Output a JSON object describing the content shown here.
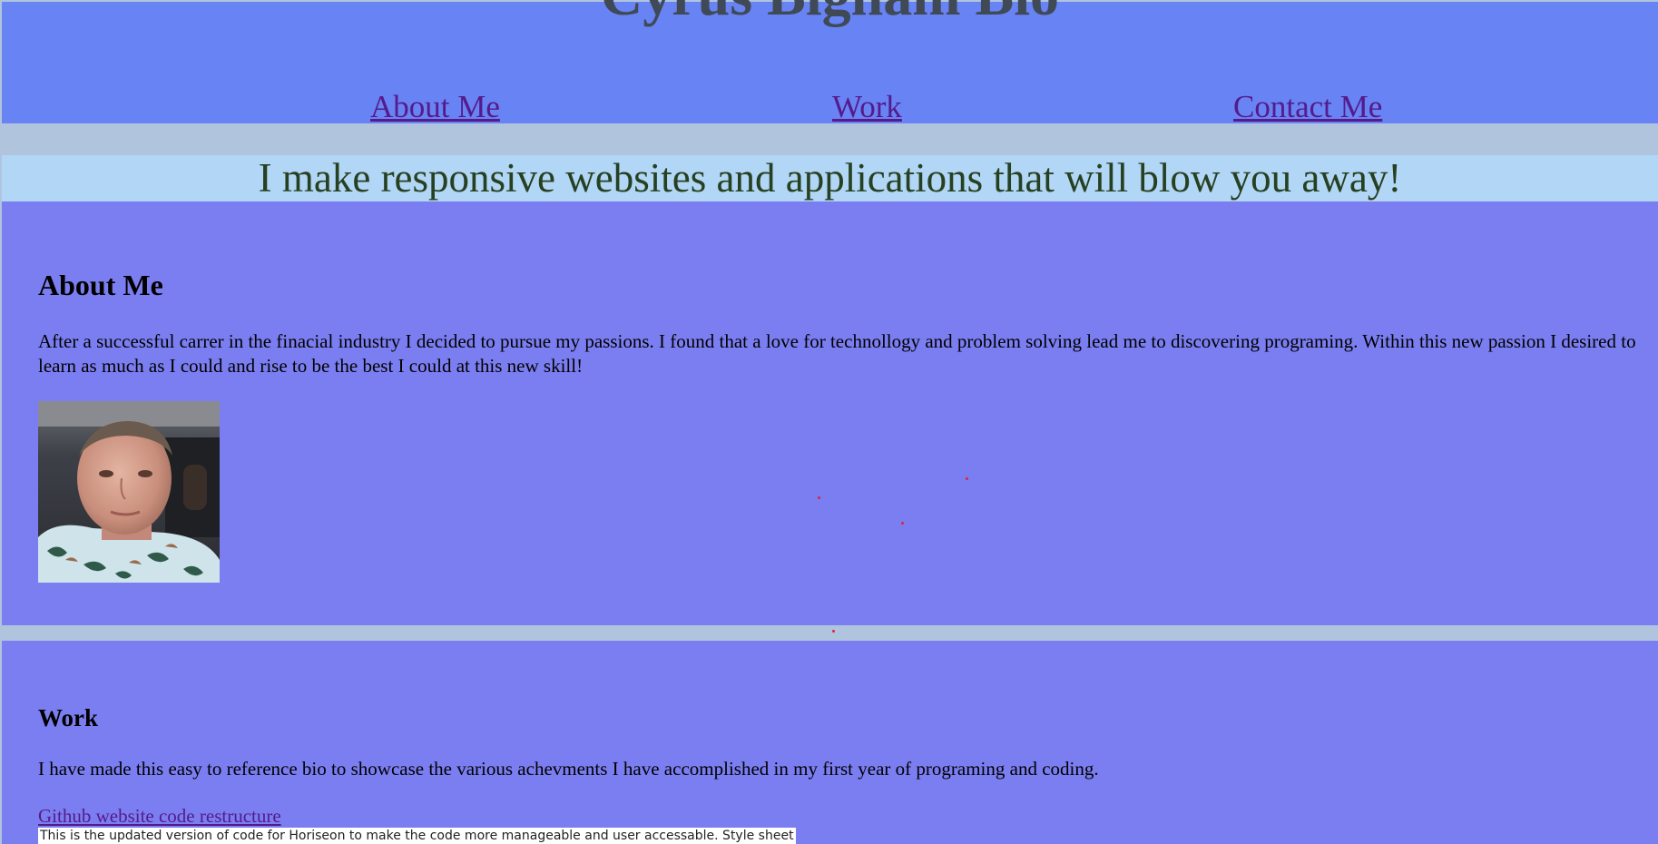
{
  "header": {
    "title": "Cyrus Bigham Bio",
    "nav": {
      "about": "About Me",
      "work": "Work",
      "contact": "Contact Me"
    }
  },
  "hero": {
    "text": "I make responsive websites and applications that will blow you away!"
  },
  "about": {
    "heading": "About Me",
    "body": "After a successful carrer in the finacial industry I decided to pursue my passions. I found that a love for technollogy and problem solving lead me to discovering programing. Within this new passion I desired to learn as much as I could and rise to be the best I could at this new skill!"
  },
  "work": {
    "heading": "Work",
    "body": "I have made this easy to reference bio to showcase the various achevments I have accomplished in my first year of programing and coding.",
    "project_link": "Github website code restructure",
    "project_desc": "This is the updated version of code for Horiseon to make the code more manageable and user accessable. Style sheet"
  },
  "colors": {
    "header_bg": "#6883f3",
    "hero_bg": "#b2d6f5",
    "section_bg": "#7b7ef0",
    "page_bg": "#b0c4de",
    "link": "#551a8b"
  }
}
